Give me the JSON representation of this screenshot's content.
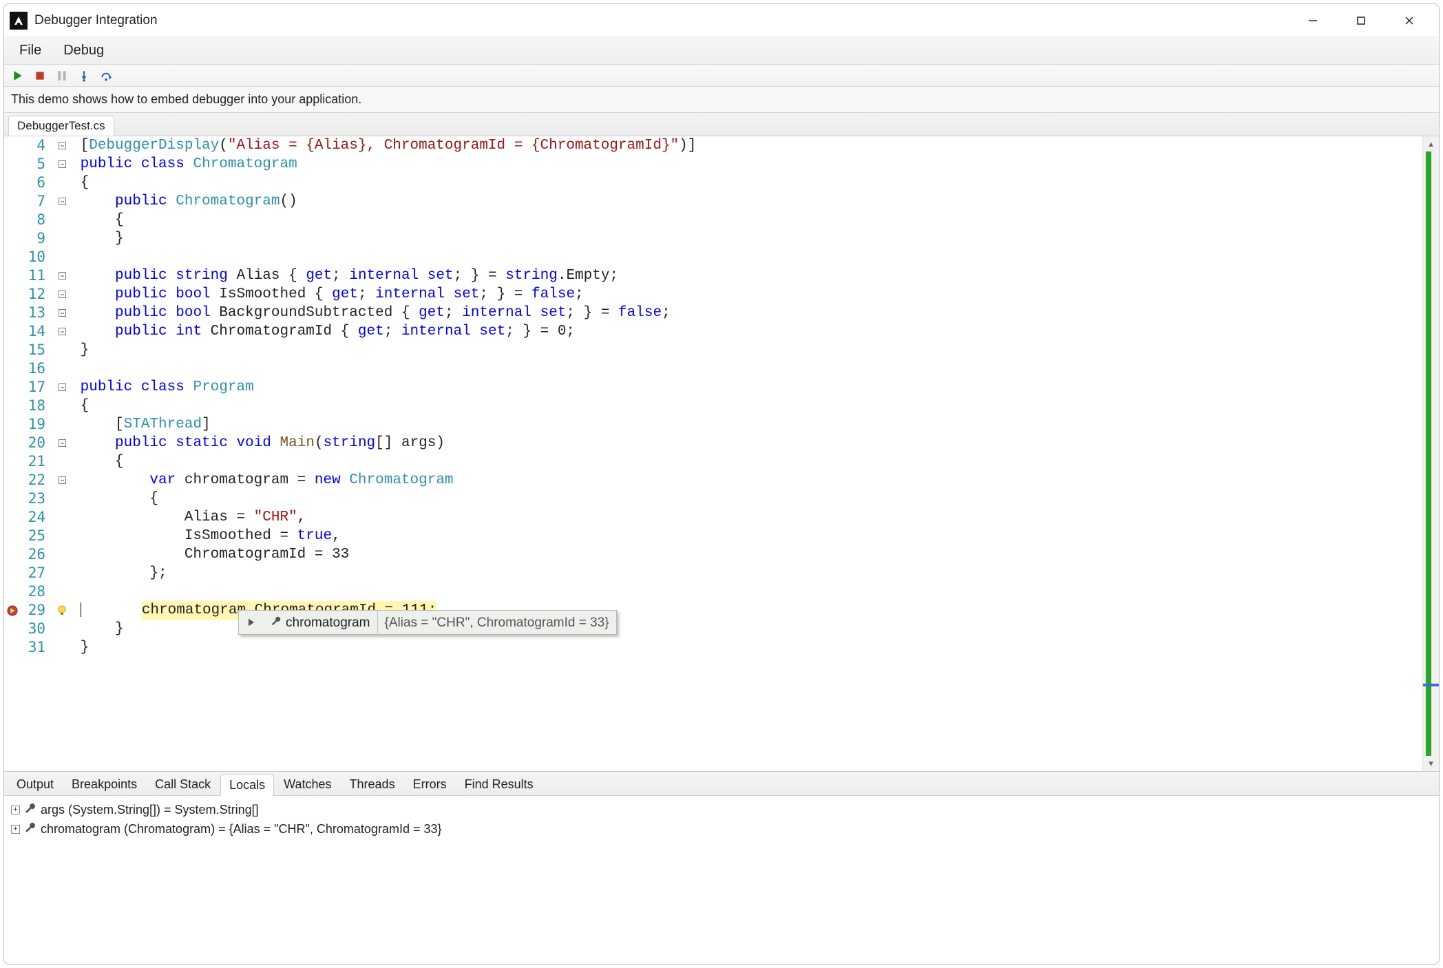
{
  "window": {
    "title": "Debugger Integration"
  },
  "menu": {
    "file": "File",
    "debug": "Debug"
  },
  "info_text": "This demo shows how to embed debugger into your application.",
  "file_tab": "DebuggerTest.cs",
  "hover_tip": {
    "name": "chromatogram",
    "value": "{Alias = \"CHR\", ChromatogramId = 33}"
  },
  "panels": {
    "tabs": {
      "output": "Output",
      "breakpoints": "Breakpoints",
      "callstack": "Call Stack",
      "locals": "Locals",
      "watches": "Watches",
      "threads": "Threads",
      "errors": "Errors",
      "findresults": "Find Results"
    },
    "locals": {
      "row0": "args (System.String[]) = System.String[]",
      "row1": "chromatogram (Chromatogram) = {Alias = \"CHR\", ChromatogramId = 33}"
    }
  },
  "code": {
    "l4_attr": "DebuggerDisplay",
    "l4_str": "\"Alias = {Alias}, ChromatogramId = {ChromatogramId}\"",
    "l5_public": "public",
    "l5_class": "class",
    "l5_type": "Chromatogram",
    "l7_public": "public",
    "l7_type": "Chromatogram",
    "l11_public": "public",
    "l11_string": "string",
    "l11_name": "Alias",
    "l11_get": "get",
    "l11_internal": "internal",
    "l11_set": "set",
    "l11_emptytype": "string",
    "l11_empty": ".Empty;",
    "l12_public": "public",
    "l12_bool": "bool",
    "l12_name": "IsSmoothed",
    "l12_get": "get",
    "l12_internal": "internal",
    "l12_set": "set",
    "l12_false": "false",
    "l13_public": "public",
    "l13_bool": "bool",
    "l13_name": "BackgroundSubtracted",
    "l13_get": "get",
    "l13_internal": "internal",
    "l13_set": "set",
    "l13_false": "false",
    "l14_public": "public",
    "l14_int": "int",
    "l14_name": "ChromatogramId",
    "l14_get": "get",
    "l14_internal": "internal",
    "l14_set": "set",
    "l17_public": "public",
    "l17_class": "class",
    "l17_type": "Program",
    "l19_STA": "STAThread",
    "l20_public": "public",
    "l20_static": "static",
    "l20_void": "void",
    "l20_main": "Main",
    "l20_string": "string",
    "l22_var": "var",
    "l22_name": "chromatogram",
    "l22_new": "new",
    "l22_type": "Chromatogram",
    "l24_alias": "Alias = ",
    "l24_str": "\"CHR\"",
    "l25_smooth": "IsSmoothed = ",
    "l25_true": "true",
    "l26": "ChromatogramId = 33",
    "l29": "chromatogram.ChromatogramId = 111;"
  },
  "line_numbers": [
    "4",
    "5",
    "6",
    "7",
    "8",
    "9",
    "10",
    "11",
    "12",
    "13",
    "14",
    "15",
    "16",
    "17",
    "18",
    "19",
    "20",
    "21",
    "22",
    "23",
    "24",
    "25",
    "26",
    "27",
    "28",
    "29",
    "30",
    "31"
  ]
}
